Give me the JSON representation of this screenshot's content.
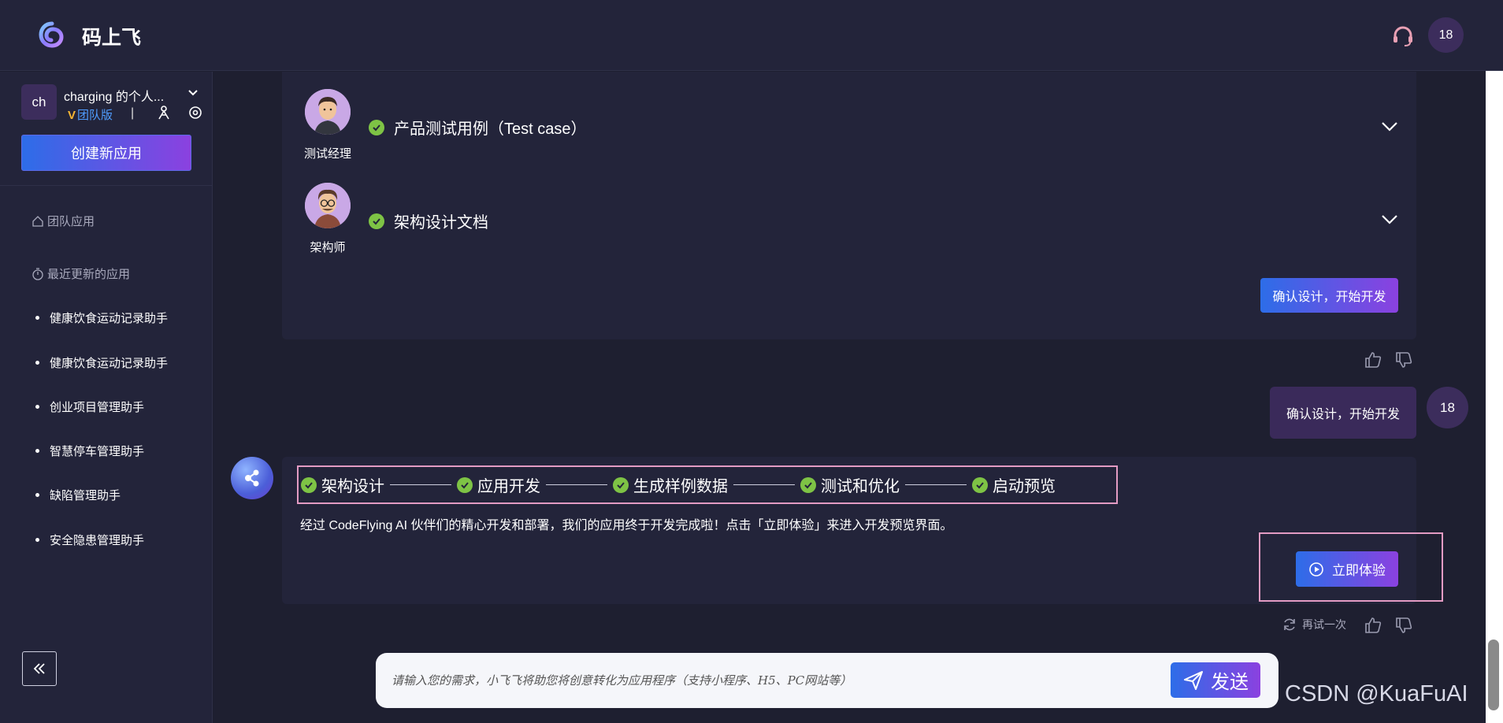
{
  "header": {
    "app_title": "码上飞",
    "user_badge": "18",
    "logo_icon": "spiral-logo-icon",
    "support_icon": "headset-icon"
  },
  "sidebar": {
    "team_avatar": "ch",
    "team_name": "charging 的个人...",
    "edition_mark": "V",
    "edition": "团队版",
    "separator": "|",
    "create_button": "创建新应用",
    "sections": {
      "team_apps": "团队应用",
      "recent_apps": "最近更新的应用"
    },
    "recent_items": [
      "健康饮食运动记录助手",
      "健康饮食运动记录助手",
      "创业项目管理助手",
      "智慧停车管理助手",
      "缺陷管理助手",
      "安全隐患管理助手"
    ]
  },
  "chat": {
    "documents": [
      {
        "role": "测试经理",
        "title": "产品测试用例（Test case）"
      },
      {
        "role": "架构师",
        "title": "架构设计文档"
      }
    ],
    "confirm_button": "确认设计，开始开发",
    "user_message": "确认设计，开始开发",
    "user_avatar": "18",
    "steps": [
      "架构设计",
      "应用开发",
      "生成样例数据",
      "测试和优化",
      "启动预览"
    ],
    "done_message": "经过 CodeFlying AI 伙伴们的精心开发和部署，我们的应用终于开发完成啦！点击「立即体验」来进入开发预览界面。",
    "try_button": "立即体验",
    "retry_label": "再试一次"
  },
  "input": {
    "placeholder": "请输入您的需求，小飞飞将助您将创意转化为应用程序（支持小程序、H5、PC网站等）",
    "send_label": "发送"
  },
  "watermark": "CSDN @KuaFuAI",
  "colors": {
    "accent_gradient_start": "#2d6de8",
    "accent_gradient_end": "#8b41e0",
    "check_green": "#7ec345",
    "highlight_pink": "#e39bc3",
    "edition_blue": "#4f9dff"
  }
}
